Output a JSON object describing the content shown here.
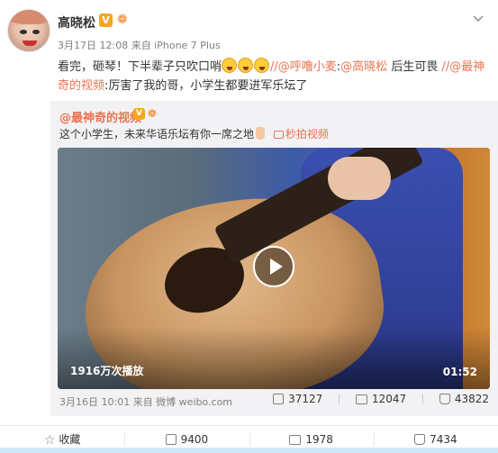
{
  "post": {
    "username": "高晓松",
    "verified_badge": "V",
    "meta": "3月17日 12:08 来自 iPhone 7 Plus",
    "text_plain_1": "看完，砸琴！下半辈子只吹口哨",
    "text_link_1": "//@呼噜小麦",
    "text_plain_2": ":",
    "text_link_2": "@高晓松",
    "text_plain_3": " 后生可畏 ",
    "text_link_3": "//@最神奇的视频",
    "text_plain_4": ":厉害了我的哥，小学生都要进军乐坛了"
  },
  "repost": {
    "username": "@最神奇的视频",
    "verified_badge": "V",
    "text": "这个小学生，未来华语乐坛有你一席之地",
    "video_link": "秒拍视频",
    "views": "1916万次播放",
    "duration": "01:52",
    "meta": "3月16日 10:01 来自 微博 weibo.com",
    "shares": "37127",
    "comments": "12047",
    "likes": "43822"
  },
  "actions": {
    "favorite": "收藏",
    "share": "9400",
    "comment": "1978",
    "like": "7434"
  },
  "icons": {
    "more": "chevron-down-icon",
    "play": "play-icon",
    "share": "share-icon",
    "comment": "comment-icon",
    "like": "thumbs-up-icon",
    "favorite": "star-icon"
  },
  "colors": {
    "link": "#eb7350",
    "badge": "#f5a623",
    "repost_bg": "#f2f2f5"
  }
}
